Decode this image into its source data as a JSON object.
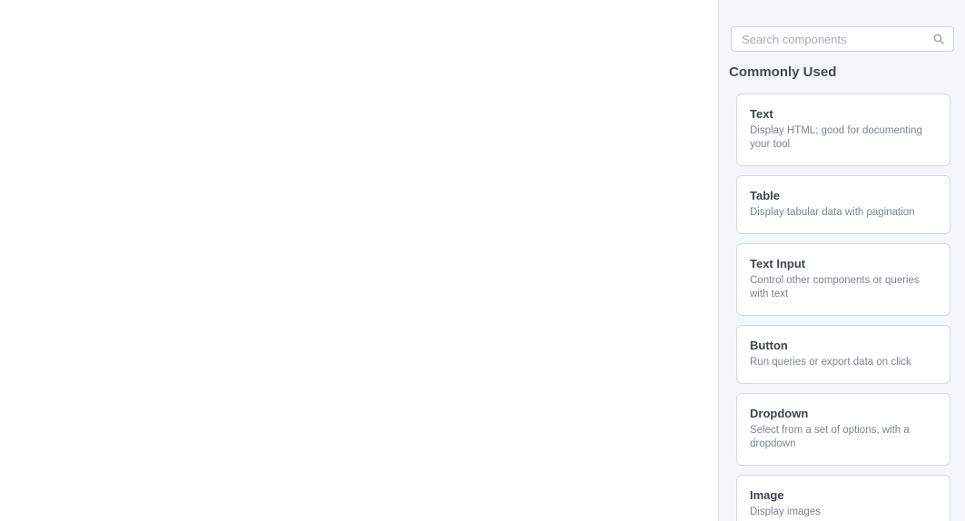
{
  "search": {
    "placeholder": "Search components",
    "icon": "search-icon"
  },
  "section": {
    "title": "Commonly Used"
  },
  "components": [
    {
      "title": "Text",
      "description": "Display HTML; good for documenting your tool"
    },
    {
      "title": "Table",
      "description": "Display tabular data with pagination"
    },
    {
      "title": "Text Input",
      "description": "Control other components or queries with text"
    },
    {
      "title": "Button",
      "description": "Run queries or export data on click"
    },
    {
      "title": "Dropdown",
      "description": "Select from a set of options, with a dropdown"
    },
    {
      "title": "Image",
      "description": "Display images"
    }
  ],
  "colors": {
    "panel_background": "#f4f7fa",
    "card_border": "#d3dae1",
    "heading": "#414c57",
    "muted_text": "#7b8691"
  }
}
